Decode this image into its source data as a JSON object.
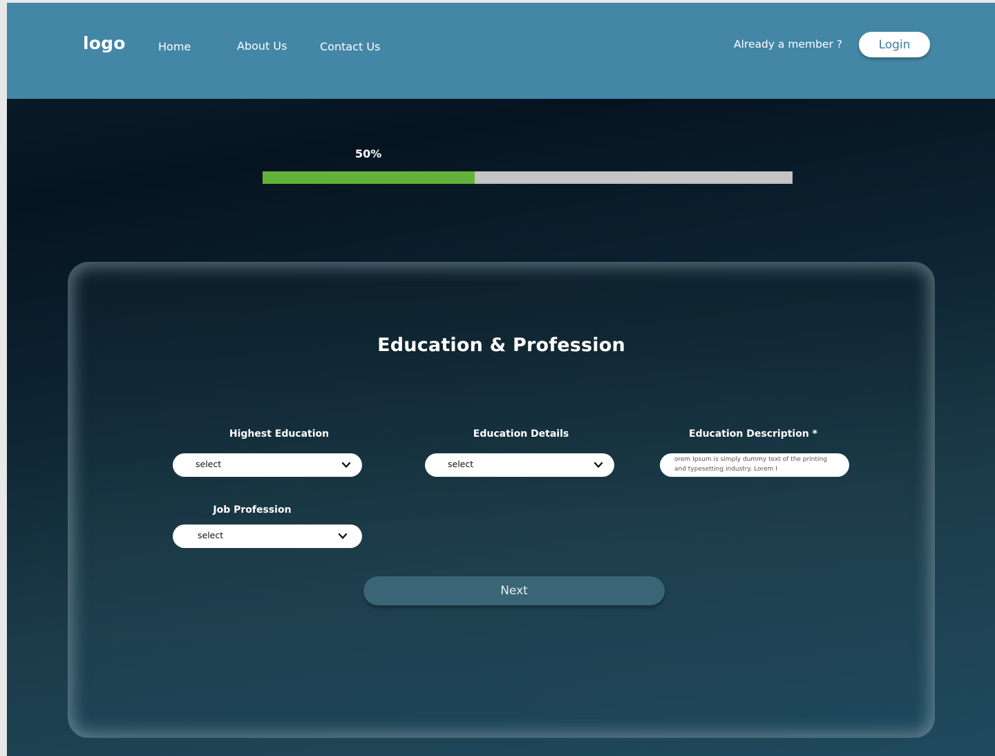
{
  "nav": {
    "logo": "logo",
    "links": [
      "Home",
      "About Us",
      "Contact Us"
    ],
    "member_text": "Already a member ?",
    "login_label": "Login"
  },
  "progress": {
    "label": "50%",
    "fraction": 0.4
  },
  "form": {
    "title": "Education & Profession",
    "fields": {
      "highest_education": {
        "label": "Highest Education",
        "value": "select"
      },
      "education_details": {
        "label": "Education Details",
        "value": "select"
      },
      "education_description": {
        "label": "Education Description *",
        "value": "orem Ipsum is simply dummy text of the printing and typesetting industry. Lorem I"
      },
      "job_profession": {
        "label": "Job Profession",
        "value": "select"
      }
    },
    "next_label": "Next"
  },
  "colors": {
    "header": "#4386a6",
    "progress_fill": "#63b33b",
    "progress_track": "#c4c4c4",
    "next_button": "#3a6577"
  }
}
